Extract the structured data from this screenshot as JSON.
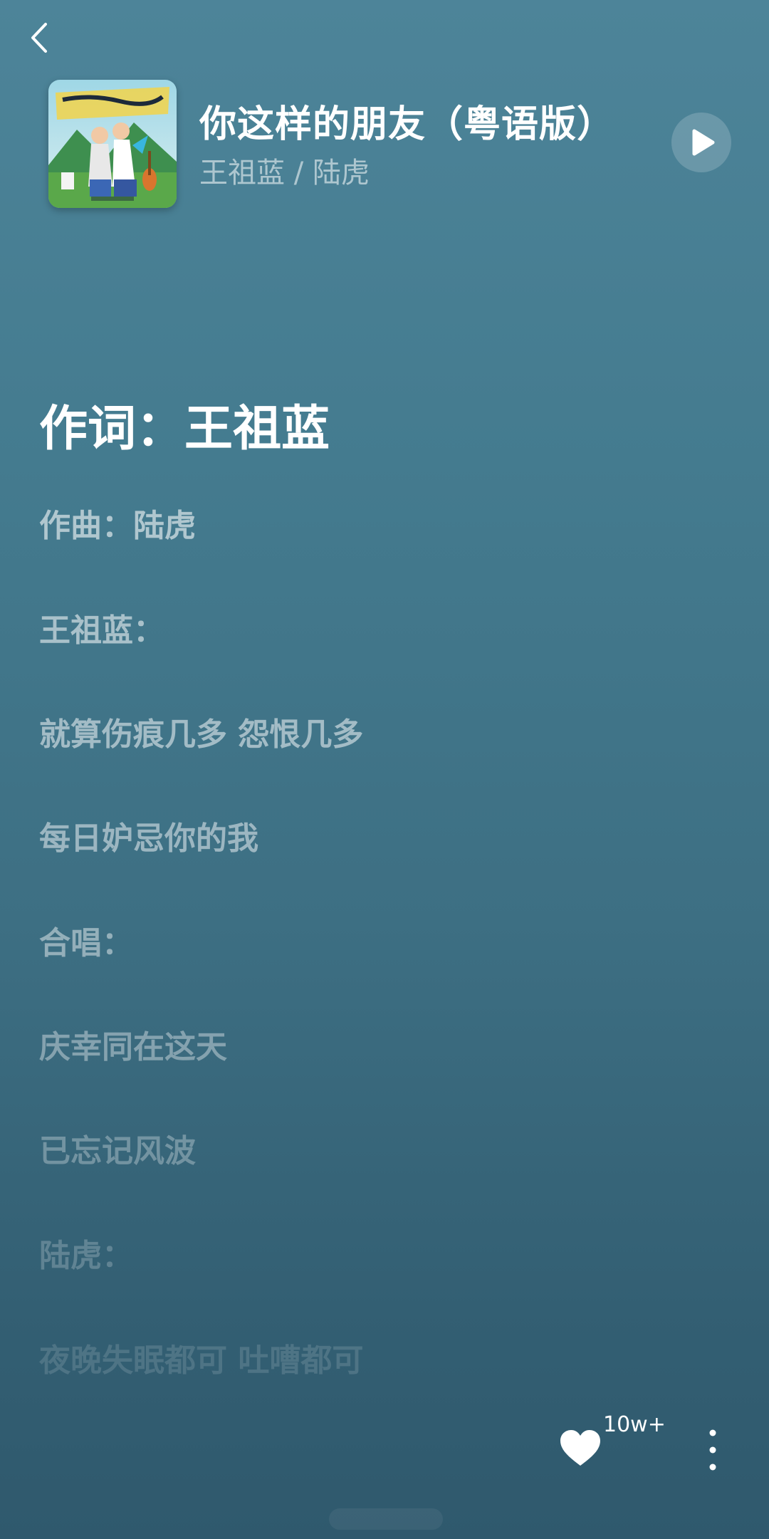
{
  "song": {
    "title": "你这样的朋友（粤语版）",
    "artist": "王祖蓝 / 陆虎"
  },
  "lyrics": {
    "active_line": "作词：王祖蓝",
    "lines": [
      "作曲：陆虎",
      "王祖蓝：",
      "就算伤痕几多 怨恨几多",
      "每日妒忌你的我",
      "合唱：",
      "庆幸同在这天",
      "已忘记风波",
      "陆虎：",
      "夜晚失眠都可 吐嘈都可"
    ]
  },
  "actions": {
    "like_count": "10w+"
  },
  "icons": {
    "back": "chevron-left-icon",
    "play": "play-icon",
    "like": "heart-icon",
    "more": "more-vertical-icon"
  },
  "colors": {
    "background_top": "#4d8499",
    "background_bottom": "#2f596d",
    "text_primary": "#ffffff"
  }
}
